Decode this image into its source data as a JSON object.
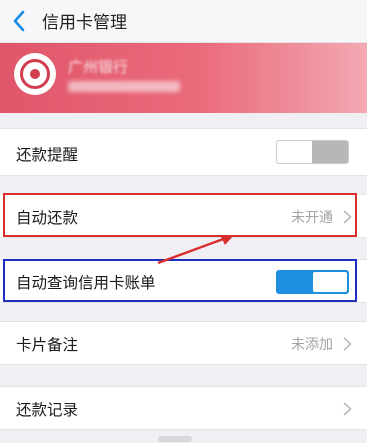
{
  "navbar": {
    "title": "信用卡管理",
    "back_icon": "chevron-left-icon"
  },
  "card": {
    "bank_name": "广州银行",
    "banner_color": "#e45a6e",
    "logo_color": "#d13c4f"
  },
  "settings": {
    "repay_reminder": {
      "label": "还款提醒",
      "toggle_on": false
    },
    "auto_repay": {
      "label": "自动还款",
      "value": "未开通"
    },
    "auto_query_bill": {
      "label": "自动查询信用卡账单",
      "toggle_on": true
    },
    "card_note": {
      "label": "卡片备注",
      "value": "未添加"
    },
    "repay_records": {
      "label": "还款记录"
    }
  },
  "colors": {
    "accent": "#1f8fe0",
    "highlight_red": "#d92e2e",
    "highlight_blue": "#1d2fbf"
  }
}
